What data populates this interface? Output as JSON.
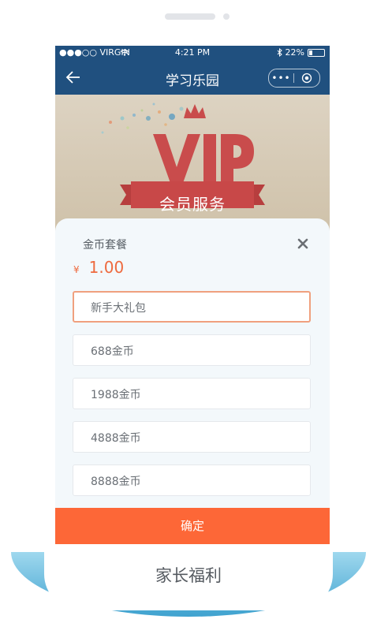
{
  "device": {
    "status_bar": {
      "carrier": "●●●○○ VIRGIN",
      "time": "4:21 PM",
      "battery": "22%",
      "icons": [
        "wifi-icon",
        "bluetooth-icon",
        "battery-icon"
      ]
    }
  },
  "nav": {
    "title": "学习乐园",
    "back_icon": "back-arrow-icon",
    "more": "•••",
    "target_icon": "target-icon"
  },
  "hero": {
    "vip_logo": "VIP",
    "banner": "会员服务"
  },
  "sheet": {
    "title": "金币套餐",
    "currency": "¥",
    "price": "1.00",
    "close_icon": "close-icon",
    "options": [
      {
        "label": "新手大礼包",
        "selected": true
      },
      {
        "label": "688金币",
        "selected": false
      },
      {
        "label": "1988金币",
        "selected": false
      },
      {
        "label": "4888金币",
        "selected": false
      },
      {
        "label": "8888金币",
        "selected": false
      }
    ],
    "confirm_label": "确定"
  },
  "caption": "家长福利",
  "colors": {
    "nav": "#20507f",
    "accent": "#fd6737",
    "price": "#ee6a3e",
    "selected_border": "#f0a07e",
    "sheet_bg": "#f3f8fb"
  }
}
